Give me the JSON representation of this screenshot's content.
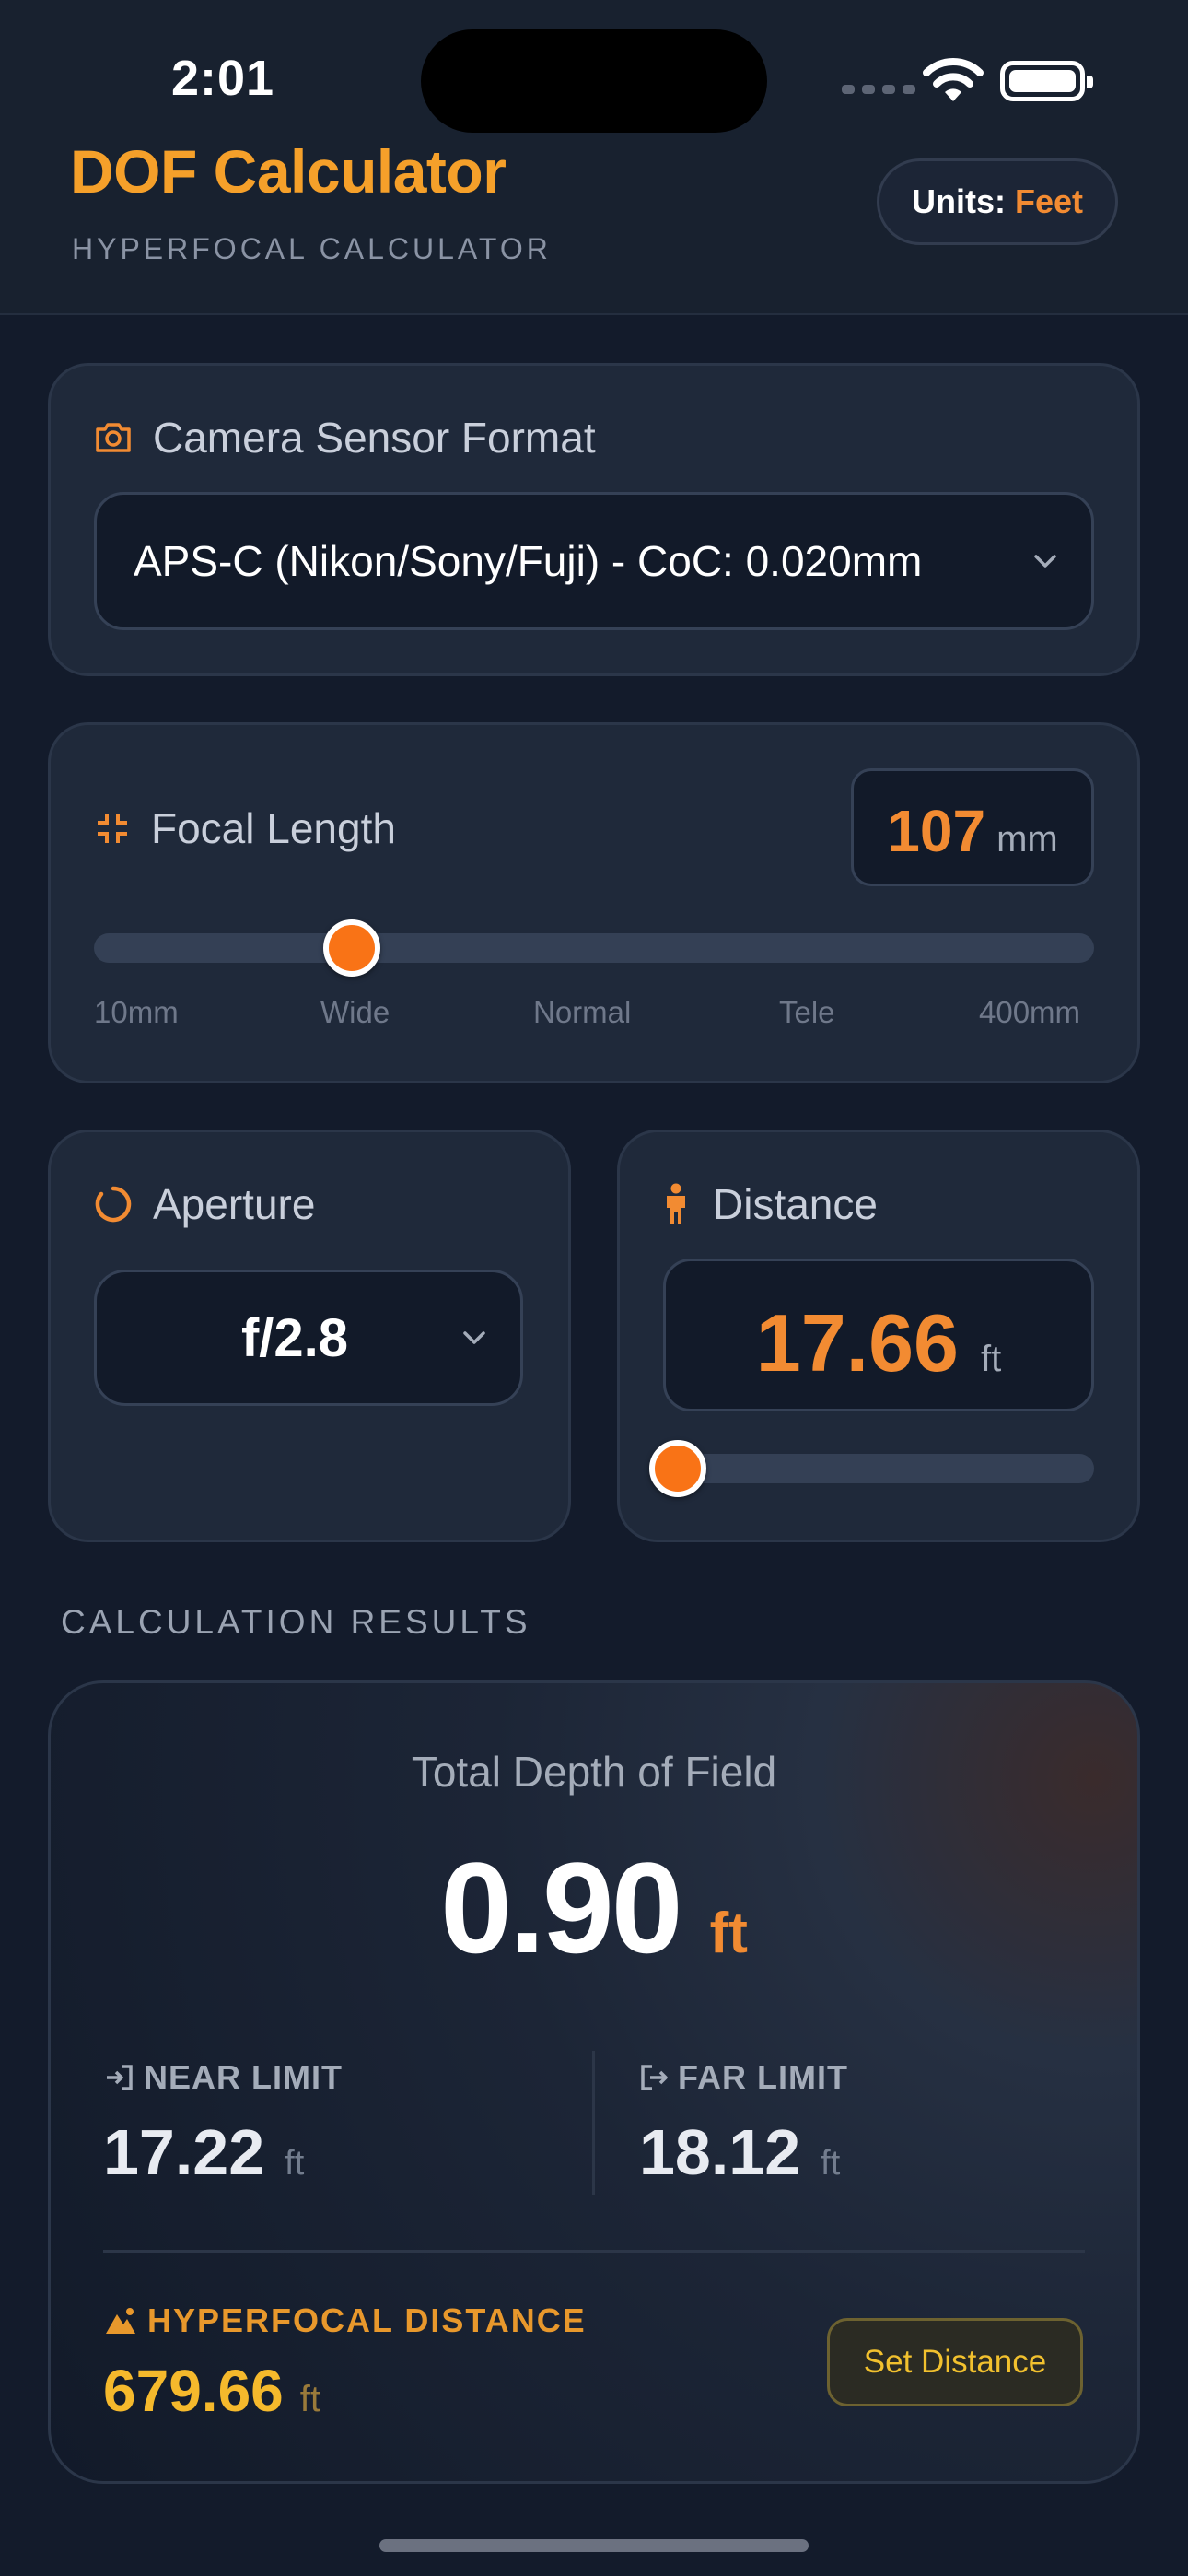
{
  "status_bar": {
    "time": "2:01"
  },
  "header": {
    "title": "DOF Calculator",
    "subtitle": "HYPERFOCAL CALCULATOR",
    "units_label": "Units:",
    "units_value": "Feet"
  },
  "sensor": {
    "label": "Camera Sensor Format",
    "selected": "APS-C (Nikon/Sony/Fuji) - CoC: 0.020mm",
    "icon": "camera-icon"
  },
  "focal_length": {
    "label": "Focal Length",
    "value": "107",
    "unit": "mm",
    "slider_fraction": 0.25,
    "ticks": [
      "10mm",
      "Wide",
      "Normal",
      "Tele",
      "400mm"
    ],
    "icon": "focus-frame-icon"
  },
  "aperture": {
    "label": "Aperture",
    "selected": "f/2.8",
    "icon": "aperture-ring-icon"
  },
  "distance": {
    "label": "Distance",
    "value": "17.66",
    "unit": "ft",
    "slider_fraction": 0.0,
    "icon": "person-icon"
  },
  "results": {
    "heading": "CALCULATION RESULTS",
    "total_label": "Total Depth of Field",
    "total_value": "0.90",
    "total_unit": "ft",
    "near_label": "NEAR LIMIT",
    "near_value": "17.22",
    "near_unit": "ft",
    "far_label": "FAR LIMIT",
    "far_value": "18.12",
    "far_unit": "ft",
    "hyperfocal_label": "HYPERFOCAL DISTANCE",
    "hyperfocal_value": "679.66",
    "hyperfocal_unit": "ft",
    "set_button": "Set Distance"
  },
  "colors": {
    "accent": "#f28b32",
    "title": "#f5a02a",
    "hyperfocal": "#f5b92c",
    "background": "#131b2b",
    "card": "#1f293a"
  }
}
